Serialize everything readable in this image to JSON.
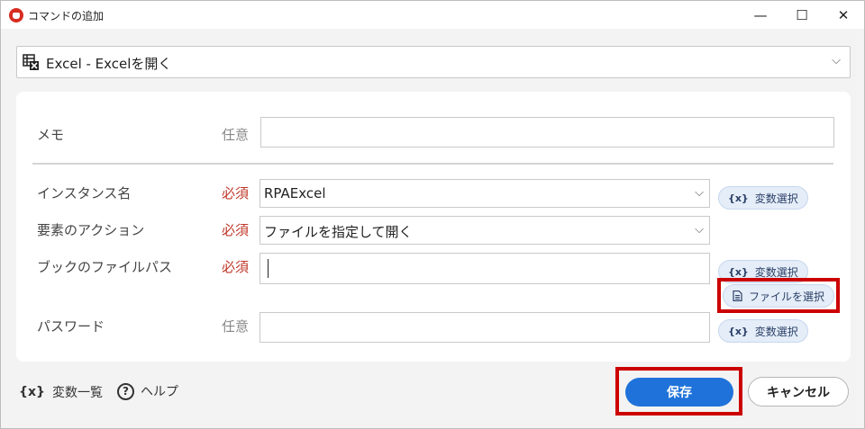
{
  "window": {
    "title": "コマンドの追加",
    "minimize_glyph": "—",
    "maximize_glyph": "☐",
    "close_glyph": "✕"
  },
  "command": {
    "selected": "Excel - Excelを開く",
    "icon": "excel-sheet-icon"
  },
  "form": {
    "memo": {
      "label": "メモ",
      "requirement": "任意",
      "value": ""
    },
    "instance": {
      "label": "インスタンス名",
      "requirement": "必須",
      "value": "RPAExcel"
    },
    "action": {
      "label": "要素のアクション",
      "requirement": "必須",
      "value": "ファイルを指定して開く"
    },
    "filepath": {
      "label": "ブックのファイルパス",
      "requirement": "必須",
      "value": ""
    },
    "password": {
      "label": "パスワード",
      "requirement": "任意",
      "value": ""
    }
  },
  "buttons": {
    "variable_select": "変数選択",
    "variable_icon_text": "{x}",
    "file_select": "ファイルを選択",
    "save": "保存",
    "cancel": "キャンセル"
  },
  "footer": {
    "variables_icon_text": "{x}",
    "variables_list": "変数一覧",
    "help_icon_text": "?",
    "help": "ヘルプ"
  },
  "colors": {
    "primary": "#1f72d9",
    "required": "#c0392b",
    "highlight": "#cc0000"
  }
}
